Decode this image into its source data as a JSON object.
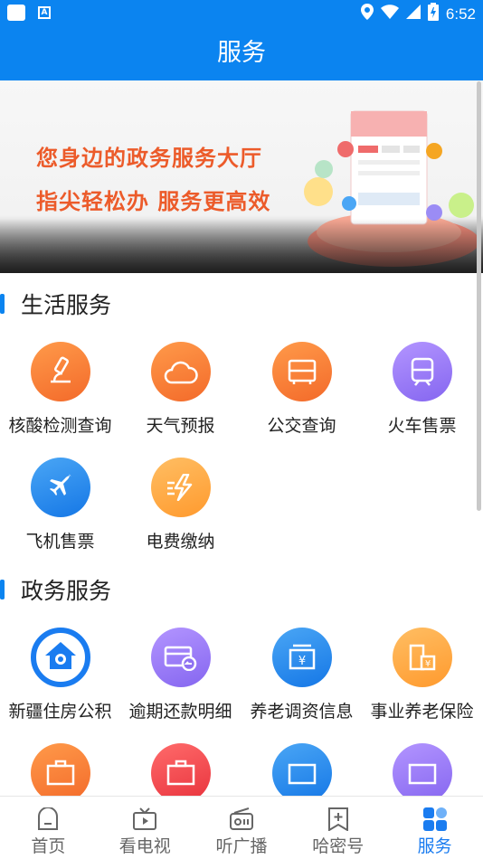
{
  "status_bar": {
    "time": "6:52"
  },
  "title": "服务",
  "banner": {
    "line1": "您身边的政务服务大厅",
    "line2": "指尖轻松办 服务更高效"
  },
  "sections": [
    {
      "title": "生活服务",
      "items": [
        {
          "label": "核酸检测查询",
          "icon": "microscope-icon",
          "color": "#f36a2a"
        },
        {
          "label": "天气预报",
          "icon": "cloud-icon",
          "color": "#f36a2a"
        },
        {
          "label": "公交查询",
          "icon": "bus-icon",
          "color": "#f36a2a"
        },
        {
          "label": "火车售票",
          "icon": "train-icon",
          "color": "#8566f0"
        },
        {
          "label": "飞机售票",
          "icon": "airplane-icon",
          "color": "#1577e6"
        },
        {
          "label": "电费缴纳",
          "icon": "lightning-icon",
          "color": "#ff9a2e"
        }
      ]
    },
    {
      "title": "政务服务",
      "items": [
        {
          "label": "新疆住房公积",
          "icon": "house-fund-icon",
          "color": "#1a7cf0"
        },
        {
          "label": "逾期还款明细",
          "icon": "card-return-icon",
          "color": "#8566f0"
        },
        {
          "label": "养老调资信息",
          "icon": "yuan-box-icon",
          "color": "#1577e6"
        },
        {
          "label": "事业养老保险",
          "icon": "building-yuan-icon",
          "color": "#ff9a2e"
        },
        {
          "label": "",
          "icon": "briefcase-yuan-icon",
          "color": "#f36a2a"
        },
        {
          "label": "",
          "icon": "briefcase-ban-icon",
          "color": "#e8323c"
        },
        {
          "label": "",
          "icon": "card-icon",
          "color": "#1577e6"
        },
        {
          "label": "",
          "icon": "card-list-icon",
          "color": "#8566f0"
        }
      ]
    }
  ],
  "bottom_nav": [
    {
      "label": "首页",
      "icon": "home-icon",
      "active": false
    },
    {
      "label": "看电视",
      "icon": "tv-icon",
      "active": false
    },
    {
      "label": "听广播",
      "icon": "radio-icon",
      "active": false
    },
    {
      "label": "哈密号",
      "icon": "bookmark-plus-icon",
      "active": false
    },
    {
      "label": "服务",
      "icon": "grid-icon",
      "active": true
    }
  ],
  "colors": {
    "primary": "#0b84f0",
    "banner_text": "#ec5b2a"
  }
}
